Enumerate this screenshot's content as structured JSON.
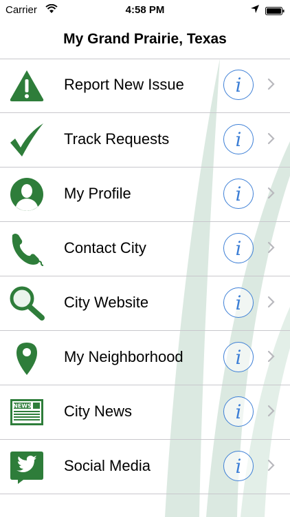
{
  "status_bar": {
    "carrier": "Carrier",
    "time": "4:58 PM"
  },
  "nav": {
    "title": "My Grand Prairie, Texas"
  },
  "menu": {
    "items": [
      {
        "label": "Report New Issue",
        "icon": "warning-icon"
      },
      {
        "label": "Track Requests",
        "icon": "checkmark-icon"
      },
      {
        "label": "My Profile",
        "icon": "profile-icon"
      },
      {
        "label": "Contact City",
        "icon": "phone-icon"
      },
      {
        "label": "City Website",
        "icon": "magnifier-icon"
      },
      {
        "label": "My Neighborhood",
        "icon": "map-pin-icon"
      },
      {
        "label": "City News",
        "icon": "newspaper-icon"
      },
      {
        "label": "Social Media",
        "icon": "twitter-icon"
      }
    ],
    "info_glyph": "i"
  },
  "colors": {
    "icon_green": "#2e7d3a",
    "info_blue": "#3d7fd6",
    "separator": "#c8c7cc"
  }
}
